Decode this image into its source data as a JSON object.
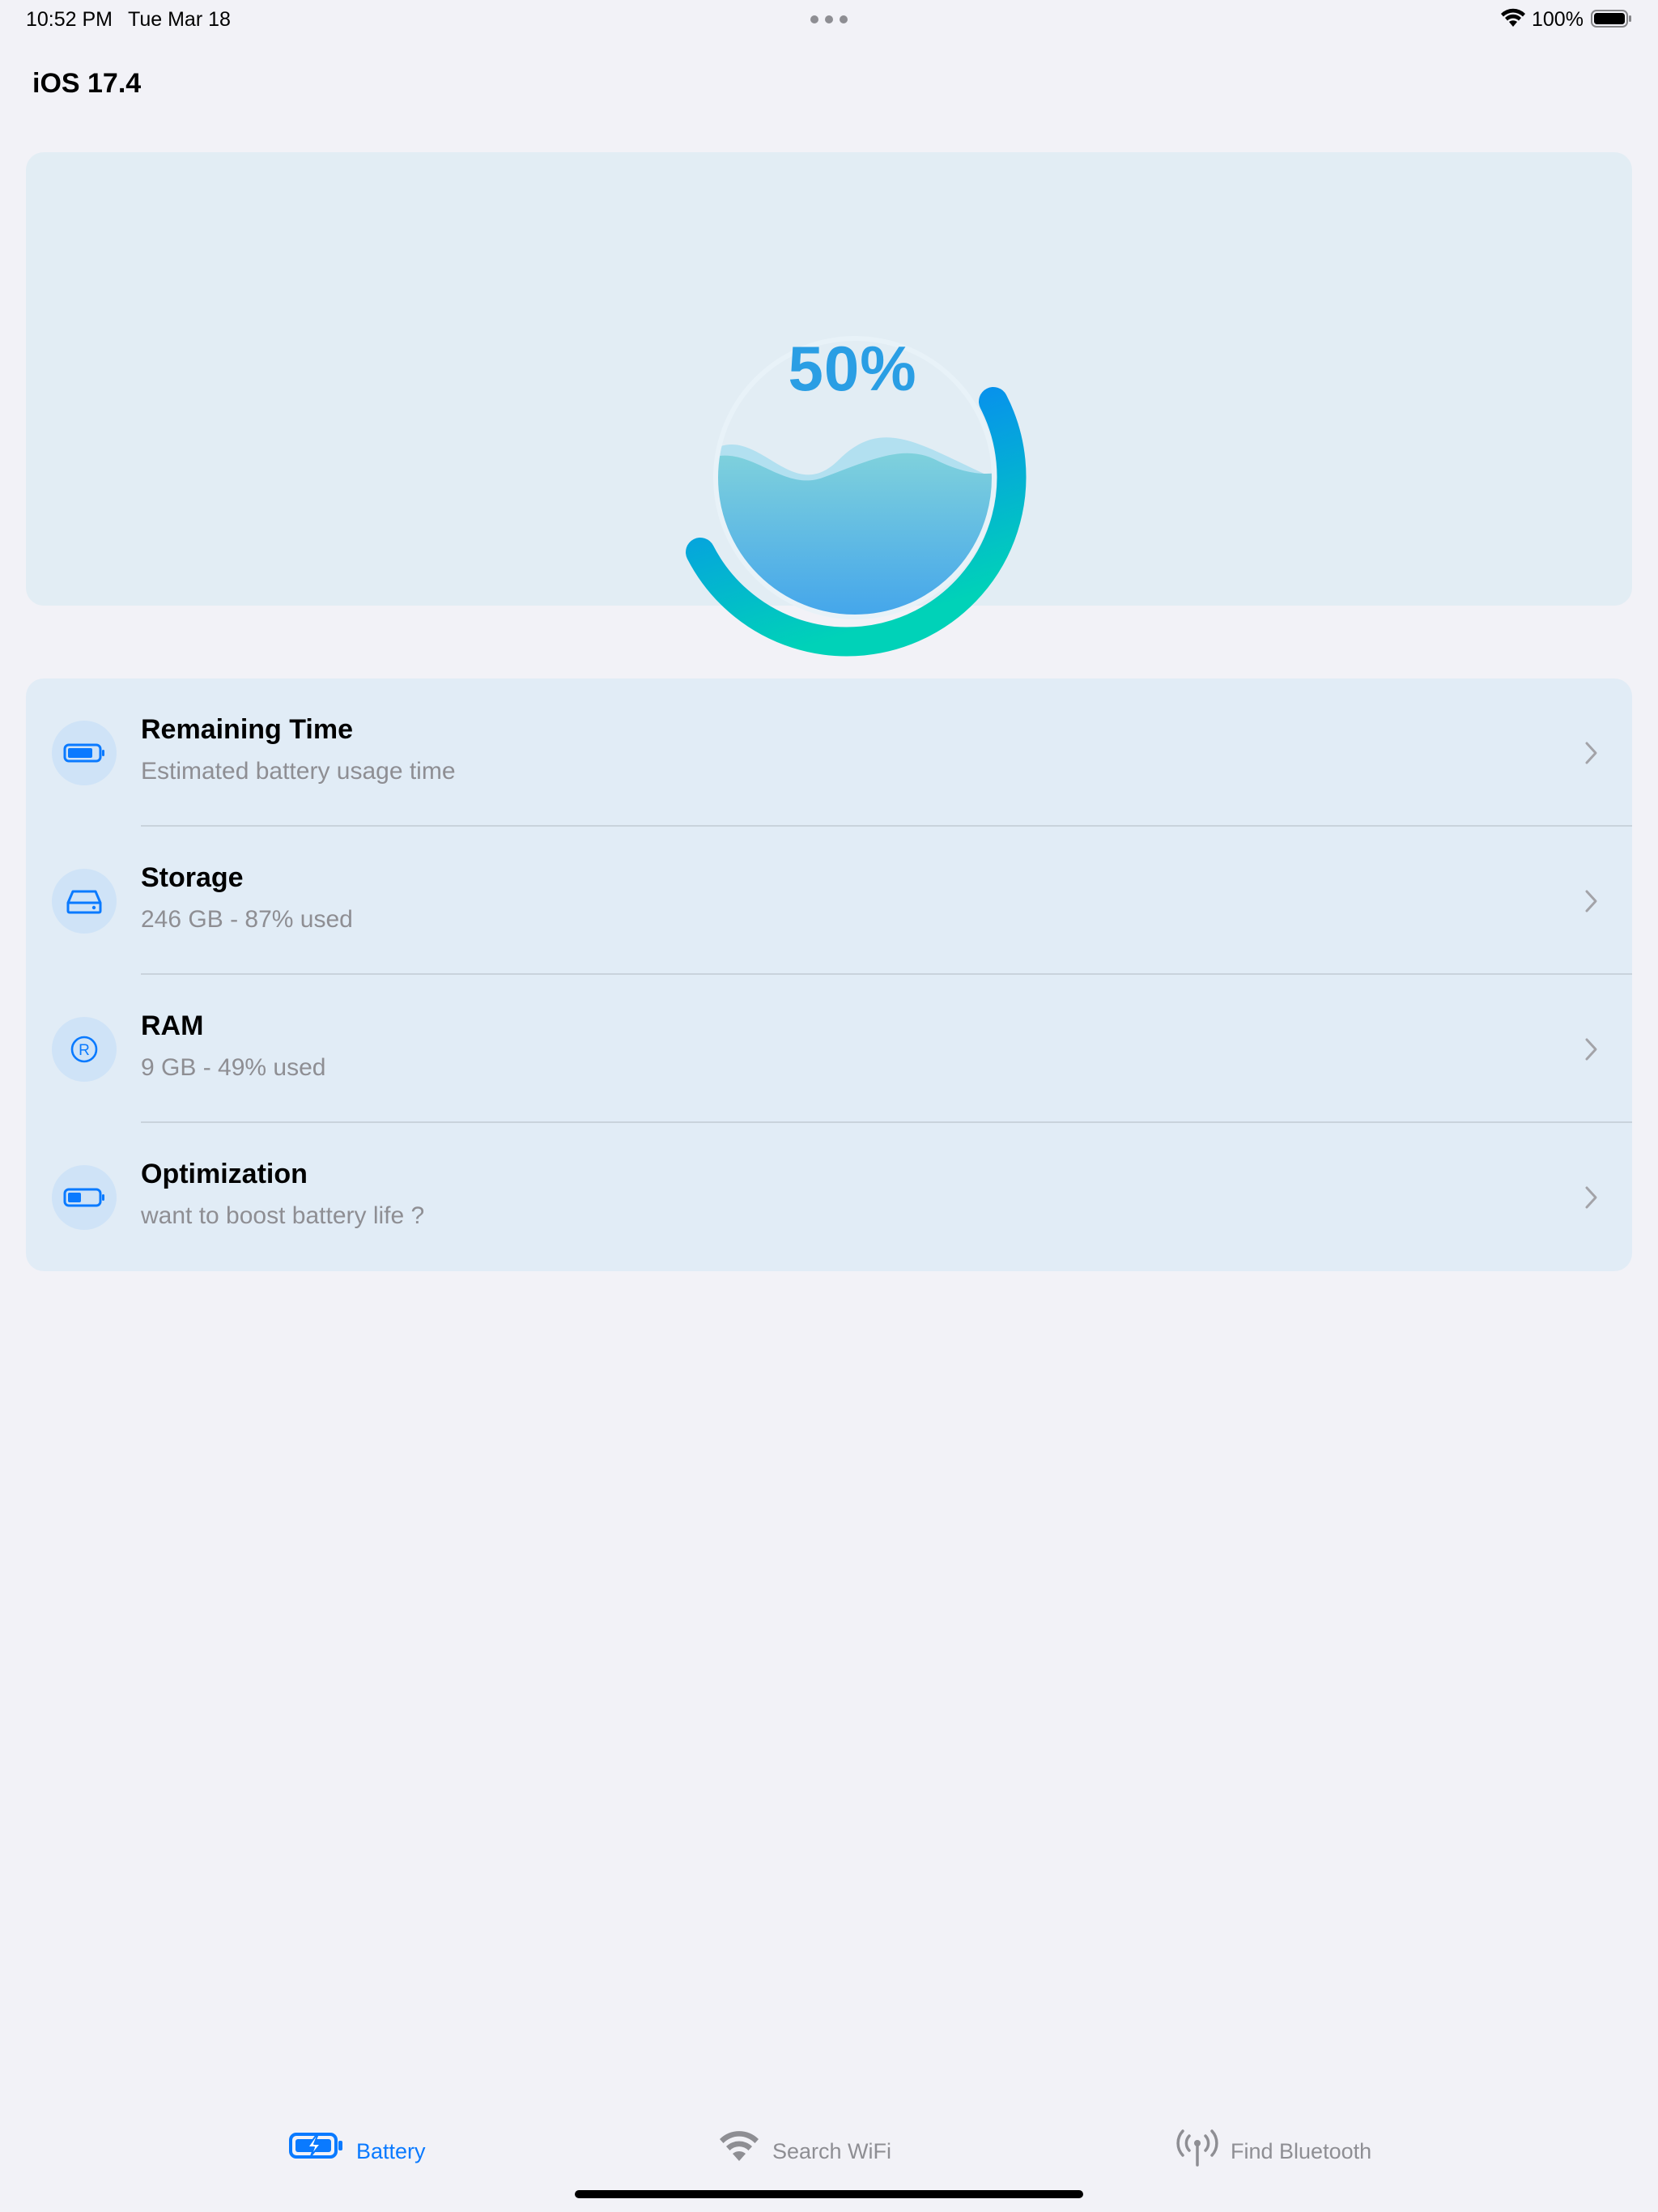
{
  "status_bar": {
    "time": "10:52 PM",
    "date": "Tue Mar 18",
    "battery_percent": "100%",
    "battery_level": 1.0,
    "wifi_icon": "wifi-icon",
    "battery_icon": "battery-full-icon",
    "multitasking_icon": "more-dots-icon"
  },
  "header": {
    "title": "iOS 17.4"
  },
  "gauge": {
    "value_label": "50%",
    "level": 0.5,
    "colors": {
      "ring_start": "#0a7aff",
      "ring_end": "#00d2b8",
      "fill_light": "#9fd8ee",
      "fill_dark": "#3fa6e8"
    }
  },
  "list": {
    "items": [
      {
        "title": "Remaining Time",
        "subtitle": "Estimated battery usage time",
        "icon": "battery-icon"
      },
      {
        "title": "Storage",
        "subtitle": "246 GB - 87% used",
        "icon": "storage-drive-icon"
      },
      {
        "title": "RAM",
        "subtitle": "9 GB - 49% used",
        "icon": "ram-r-icon"
      },
      {
        "title": "Optimization",
        "subtitle": "want to boost battery life ?",
        "icon": "battery-low-icon"
      }
    ]
  },
  "tab_bar": {
    "tabs": [
      {
        "label": "Battery",
        "icon": "battery-charging-icon",
        "active": true
      },
      {
        "label": "Search WiFi",
        "icon": "wifi-icon",
        "active": false
      },
      {
        "label": "Find Bluetooth",
        "icon": "antenna-icon",
        "active": false
      }
    ]
  },
  "colors": {
    "accent": "#0a7aff",
    "secondary_text": "#8e8e93",
    "background": "#f2f2f7"
  }
}
